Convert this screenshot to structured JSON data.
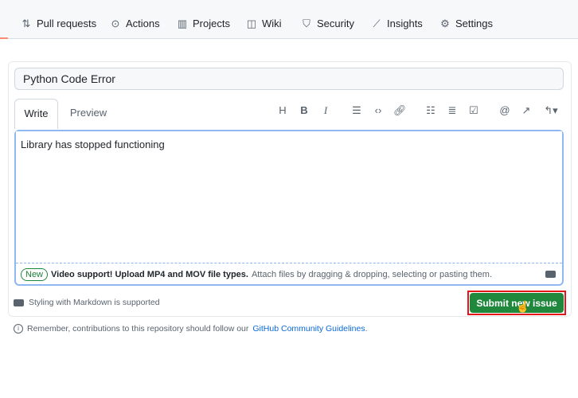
{
  "nav": {
    "items": [
      {
        "label": "Pull requests",
        "icon": "pull-request-icon"
      },
      {
        "label": "Actions",
        "icon": "play-icon"
      },
      {
        "label": "Projects",
        "icon": "project-icon"
      },
      {
        "label": "Wiki",
        "icon": "book-icon"
      },
      {
        "label": "Security",
        "icon": "shield-icon"
      },
      {
        "label": "Insights",
        "icon": "graph-icon"
      },
      {
        "label": "Settings",
        "icon": "gear-icon"
      }
    ]
  },
  "issue": {
    "title": "Python Code Error",
    "body": "Library has stopped functioning"
  },
  "tabs": {
    "write": "Write",
    "preview": "Preview"
  },
  "toolbar": [
    "heading-icon",
    "bold-icon",
    "italic-icon",
    "quote-icon",
    "code-icon",
    "link-icon",
    "unordered-list-icon",
    "ordered-list-icon",
    "task-list-icon",
    "mention-icon",
    "reference-icon",
    "reply-icon"
  ],
  "attach": {
    "badge": "New",
    "bold": "Video support! Upload MP4 and MOV file types.",
    "text": "Attach files by dragging & dropping, selecting or pasting them."
  },
  "markdown_note": "Styling with Markdown is supported",
  "submit_label": "Submit new issue",
  "footer": {
    "text": "Remember, contributions to this repository should follow our",
    "link": "GitHub Community Guidelines",
    "end": "."
  },
  "colors": {
    "accent": "#1f883d",
    "highlight": "#e5161b",
    "link": "#0969da"
  }
}
